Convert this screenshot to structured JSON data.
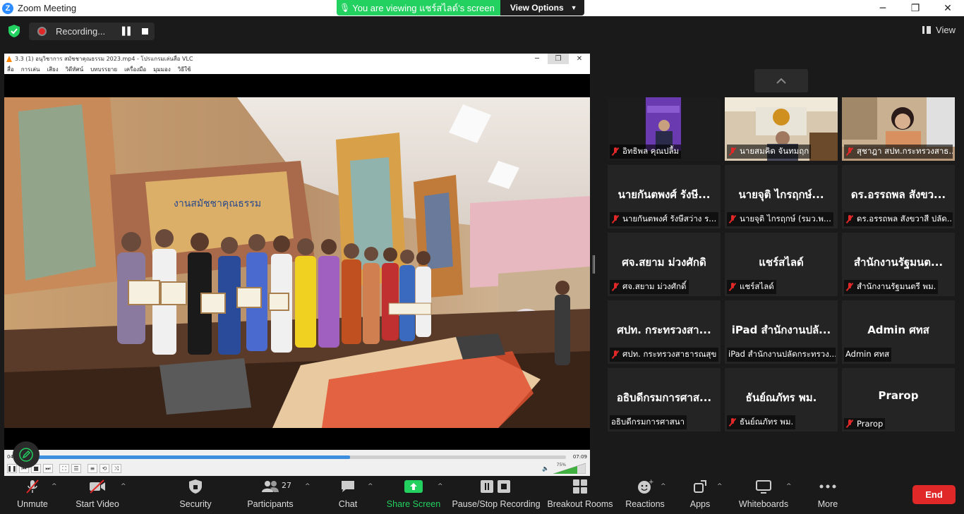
{
  "window": {
    "title": "Zoom Meeting",
    "minimize": "─",
    "maximize": "❐",
    "close": "✕"
  },
  "share_banner": {
    "viewing_text": "You are viewing แชร์สไลด์'s screen",
    "view_options": "View Options"
  },
  "topbar": {
    "recording_text": "Recording...",
    "view_label": "View"
  },
  "vlc": {
    "title": "3.3 (1) อนุวิชาการ สมัชชาคุณธรรม 2023.mp4 - โปรแกรมเล่นสื่อ VLC",
    "menu": [
      "สื่อ",
      "การเล่น",
      "เสียง",
      "วิดีทัศน์",
      "บทบรรยาย",
      "เครื่องมือ",
      "มุมมอง",
      "วิธีใช้"
    ],
    "time_start": "04:",
    "time_end": "07:09",
    "progress": 0.6,
    "volume": "75%"
  },
  "gallery": {
    "tiles": [
      {
        "label": "อิทธิพล คุณปลื้ม",
        "muted": true,
        "video": "purple"
      },
      {
        "label": "นายสมคิด จันทมฤก",
        "muted": true,
        "video": "office"
      },
      {
        "label": "สุชาฎา สปท.กระทรวงสาธ...",
        "muted": true,
        "video": "desk"
      },
      {
        "name": "นายกันตพงศ์ รังษี...",
        "label": "นายกันตพงศ์ รังษีสว่าง ร...",
        "muted": true
      },
      {
        "name": "นายจุติ ไกรฤกษ์...",
        "label": "นายจุติ ไกรฤกษ์ (รมว.พ...",
        "muted": true
      },
      {
        "name": "ดร.อรรถพล สังขว...",
        "label": "ดร.อรรถพล สังขวาสี ปลัด...",
        "muted": true
      },
      {
        "name": "ศจ.สยาม ม่วงศักดิ",
        "label": "ศจ.สยาม ม่วงศักดิ์",
        "muted": true
      },
      {
        "name": "แชร์สไลด์",
        "label": "แชร์สไลด์",
        "muted": true
      },
      {
        "name": "สำนักงานรัฐมนต...",
        "label": "สำนักงานรัฐมนตรี พม.",
        "muted": true
      },
      {
        "name": "ศปท. กระทรวงสา...",
        "label": "ศปท. กระทรวงสาธารณสุข",
        "muted": true
      },
      {
        "name": "iPad สำนักงานปลั...",
        "label": "iPad สำนักงานปลัดกระทรวง...",
        "muted": false
      },
      {
        "name": "Admin ศทส",
        "label": "Admin ศทส",
        "muted": false
      },
      {
        "name": "อธิบดีกรมการศาส...",
        "label": "อธิบดีกรมการศาสนา",
        "muted": false
      },
      {
        "name": "ธันย์ณภัทร พม.",
        "label": "ธันย์ณภัทร พม.",
        "muted": true
      },
      {
        "name": "Prarop",
        "label": "Prarop",
        "muted": true
      }
    ]
  },
  "toolbar": {
    "unmute": "Unmute",
    "start_video": "Start Video",
    "security": "Security",
    "participants": "Participants",
    "participants_count": "27",
    "chat": "Chat",
    "share_screen": "Share Screen",
    "pause_stop_recording": "Pause/Stop Recording",
    "breakout_rooms": "Breakout Rooms",
    "reactions": "Reactions",
    "apps": "Apps",
    "whiteboards": "Whiteboards",
    "more": "More",
    "end": "End"
  },
  "colors": {
    "accent_green": "#23d160",
    "end_red": "#e02828",
    "zoom_blue": "#2d8cff"
  }
}
